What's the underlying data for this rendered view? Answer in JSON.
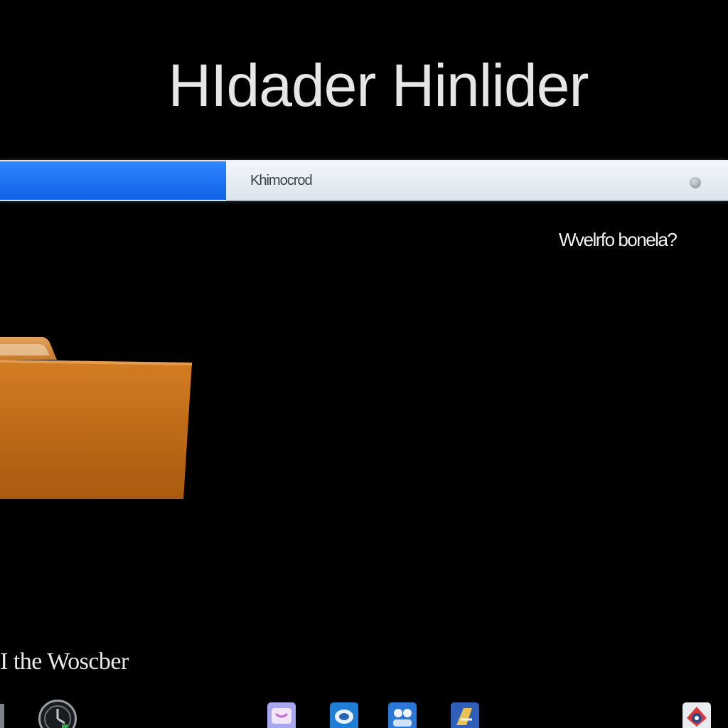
{
  "header": {
    "title": "HIdader Hinlider"
  },
  "search": {
    "placeholder": "Khimocrod"
  },
  "side_link": {
    "label": "Wvelrfo bonela?"
  },
  "folder": {
    "icon": "folder-icon",
    "color": "#c9731a"
  },
  "footer": {
    "label": "I the Woscber"
  },
  "taskbar": {
    "items": [
      {
        "icon": "app-icon-1"
      },
      {
        "icon": "clock-icon"
      },
      {
        "icon": "app-icon-messages"
      },
      {
        "icon": "app-icon-browser"
      },
      {
        "icon": "app-icon-people"
      },
      {
        "icon": "app-icon-editor"
      },
      {
        "icon": "app-icon-settings"
      }
    ]
  },
  "colors": {
    "background": "#000000",
    "accent_blue": "#1a6ff2",
    "folder_orange": "#c9731a"
  }
}
